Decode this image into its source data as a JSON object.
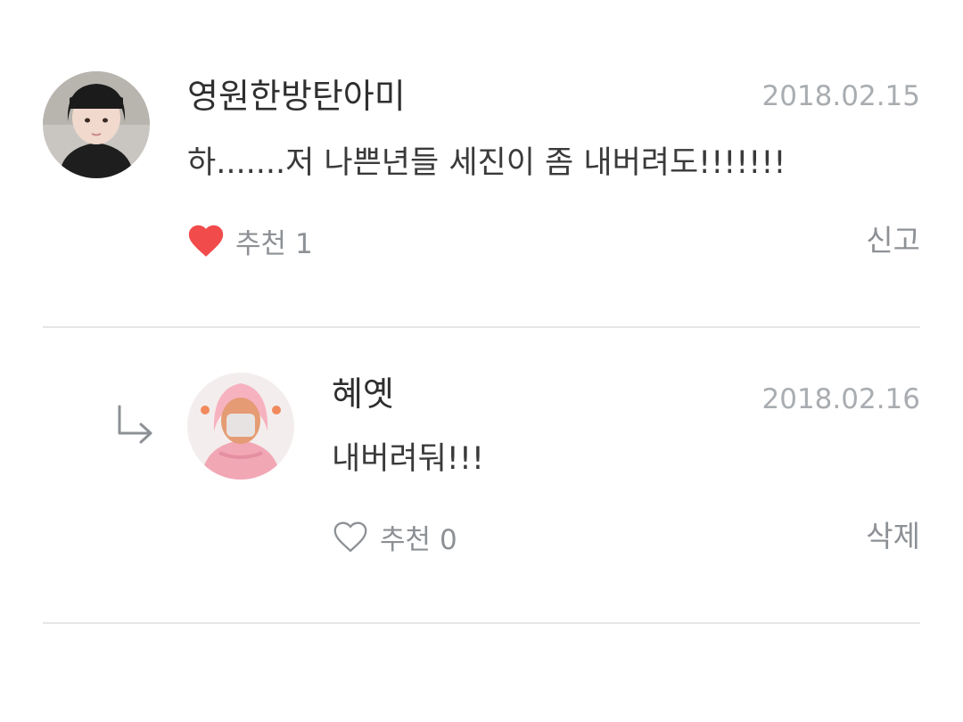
{
  "comments": [
    {
      "author": "영원한방탄아미",
      "date": "2018.02.15",
      "text": "하.......저 나쁜년들 세진이 좀 내버려도!!!!!!!",
      "like_label": "추천",
      "like_count": "1",
      "liked": true,
      "action": "신고",
      "heart_color": "#f24b4b"
    },
    {
      "author": "혜옛",
      "date": "2018.02.16",
      "text": "내버려둬!!!",
      "like_label": "추천",
      "like_count": "0",
      "liked": false,
      "action": "삭제",
      "is_reply": true,
      "reply_icon": "reply-arrow-icon"
    }
  ],
  "colors": {
    "date": "#a9adb1",
    "meta": "#8d9195",
    "divider": "#e6e6e6",
    "heart_liked": "#f24b4b"
  }
}
